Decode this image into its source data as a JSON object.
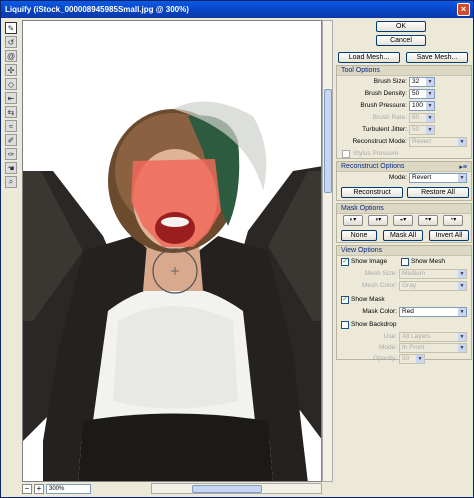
{
  "window": {
    "title": "Liquify (iStock_000008945985Small.jpg @ 300%)",
    "close_label": "×"
  },
  "tools": [
    "warp",
    "reconstruct",
    "twirl",
    "pucker",
    "bloat",
    "push-left",
    "mirror",
    "turbulence",
    "freeze-mask",
    "thaw-mask",
    "hand",
    "zoom"
  ],
  "canvas": {
    "zoom": "300%"
  },
  "buttons": {
    "ok": "OK",
    "cancel": "Cancel",
    "load_mesh": "Load Mesh...",
    "save_mesh": "Save Mesh..."
  },
  "tool_options": {
    "title": "Tool Options",
    "brush_size_label": "Brush Size:",
    "brush_size": "32",
    "brush_density_label": "Brush Density:",
    "brush_density": "50",
    "brush_pressure_label": "Brush Pressure:",
    "brush_pressure": "100",
    "brush_rate_label": "Brush Rate:",
    "brush_rate": "80",
    "turbulent_jitter_label": "Turbulent Jitter:",
    "turbulent_jitter": "50",
    "reconstruct_mode_label": "Reconstruct Mode:",
    "reconstruct_mode": "Revert",
    "stylus_pressure_label": "Stylus Pressure"
  },
  "reconstruct_options": {
    "title": "Reconstruct Options",
    "mode_label": "Mode:",
    "mode": "Revert",
    "reconstruct_label": "Reconstruct",
    "restore_all_label": "Restore All"
  },
  "mask_options": {
    "title": "Mask Options",
    "none_label": "None",
    "mask_all_label": "Mask All",
    "invert_all_label": "Invert All"
  },
  "view_options": {
    "title": "View Options",
    "show_image_label": "Show Image",
    "show_mesh_label": "Show Mesh",
    "mesh_size_label": "Mesh Size:",
    "mesh_size": "Medium",
    "mesh_color_label": "Mesh Color:",
    "mesh_color": "Gray",
    "show_mask_label": "Show Mask",
    "mask_color_label": "Mask Color:",
    "mask_color": "Red",
    "show_backdrop_label": "Show Backdrop",
    "use_label": "Use:",
    "use": "All Layers",
    "mode_label": "Mode:",
    "mode": "In Front",
    "opacity_label": "Opacity:",
    "opacity": "50"
  }
}
